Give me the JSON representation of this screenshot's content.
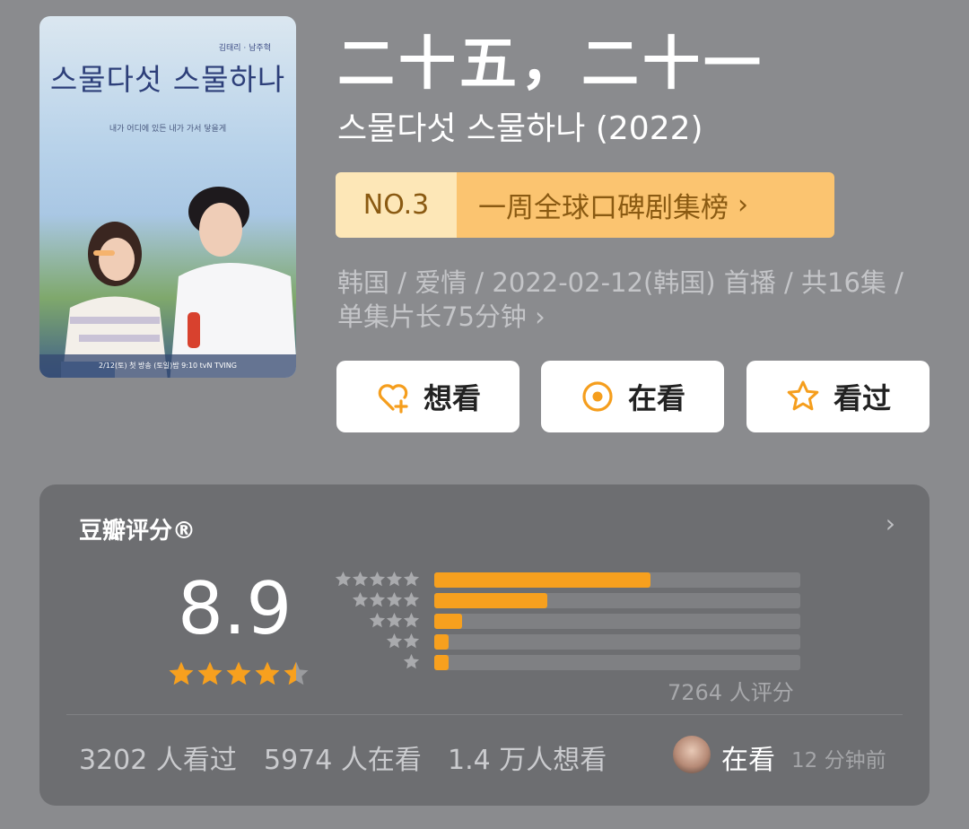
{
  "poster": {
    "title_korean": "스물다섯 스물하나",
    "cast": "김태리 · 남주혁",
    "tagline": "내가 어디에 있든 내가 가서 닿을게",
    "footer": "2/12(토) 첫 방송 (토일)밤 9:10 tvN TVING"
  },
  "title": "二十五，二十一",
  "original_title": "스물다섯 스물하나 (2022)",
  "ranking": {
    "number": "NO.3",
    "list_name": "一周全球口碑剧集榜",
    "chevron": "›"
  },
  "meta": {
    "info": "韩国 / 爱情 / 2022-02-12(韩国) 首播 / 共16集 / 单集片长75分钟",
    "chevron": "›"
  },
  "actions": {
    "want": "想看",
    "watching": "在看",
    "watched": "看过"
  },
  "rating_card": {
    "title": "豆瓣评分®",
    "chevron": "›",
    "score": "8.9",
    "stars_value": 4.5,
    "distribution": [
      {
        "stars": 5,
        "fraction": 0.59
      },
      {
        "stars": 4,
        "fraction": 0.31
      },
      {
        "stars": 3,
        "fraction": 0.075
      },
      {
        "stars": 2,
        "fraction": 0.04
      },
      {
        "stars": 1,
        "fraction": 0.04
      }
    ],
    "raters": "7264 人评分",
    "watched_count": "3202 人看过",
    "watching_count": "5974 人在看",
    "want_count": "1.4 万人想看",
    "friend_status": "在看",
    "friend_time": "12 分钟前"
  },
  "colors": {
    "background": "#8a8b8e",
    "card": "#6d6e71",
    "accent_orange": "#f7a01e",
    "rank_light": "#fde7b7",
    "rank_dark": "#fbc470"
  }
}
